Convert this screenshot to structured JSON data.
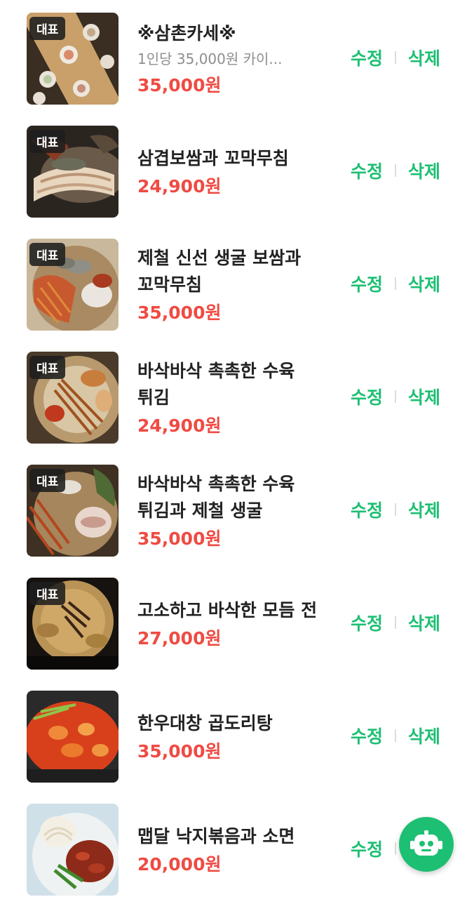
{
  "colors": {
    "accent": "#1dbf73",
    "price": "#ef4b43",
    "badge_bg": "#1e1e1e",
    "title": "#222222",
    "desc": "#8e8e8e"
  },
  "menu": {
    "edit_label": "수정",
    "delete_label": "삭제",
    "items": [
      {
        "badge": "대표",
        "name": "※삼촌카세※",
        "desc": "1인당 35,000원 카이...",
        "price": "35,000원",
        "image": "seafood-platter"
      },
      {
        "badge": "대표",
        "name": "삼겹보쌈과 꼬막무침",
        "desc": "",
        "price": "24,900원",
        "image": "bossam"
      },
      {
        "badge": "대표",
        "name": "제철 신선 생굴 보쌈과 꼬막무침",
        "desc": "",
        "price": "35,000원",
        "image": "oyster-bossam"
      },
      {
        "badge": "대표",
        "name": "바삭바삭 촉촉한 수육 튀김",
        "desc": "",
        "price": "24,900원",
        "image": "fried-pork"
      },
      {
        "badge": "대표",
        "name": "바삭바삭 촉촉한 수육 튀김과 제철 생굴",
        "desc": "",
        "price": "35,000원",
        "image": "fried-pork-oyster"
      },
      {
        "badge": "대표",
        "name": "고소하고 바삭한 모듬 전",
        "desc": "",
        "price": "27,000원",
        "image": "jeon"
      },
      {
        "badge": "",
        "name": "한우대창 곱도리탕",
        "desc": "",
        "price": "35,000원",
        "image": "gopdori-tang"
      },
      {
        "badge": "",
        "name": "맵달 낙지볶음과 소면",
        "desc": "",
        "price": "20,000원",
        "image": "nakji"
      }
    ]
  },
  "chatbot": {
    "icon": "robot-icon"
  }
}
